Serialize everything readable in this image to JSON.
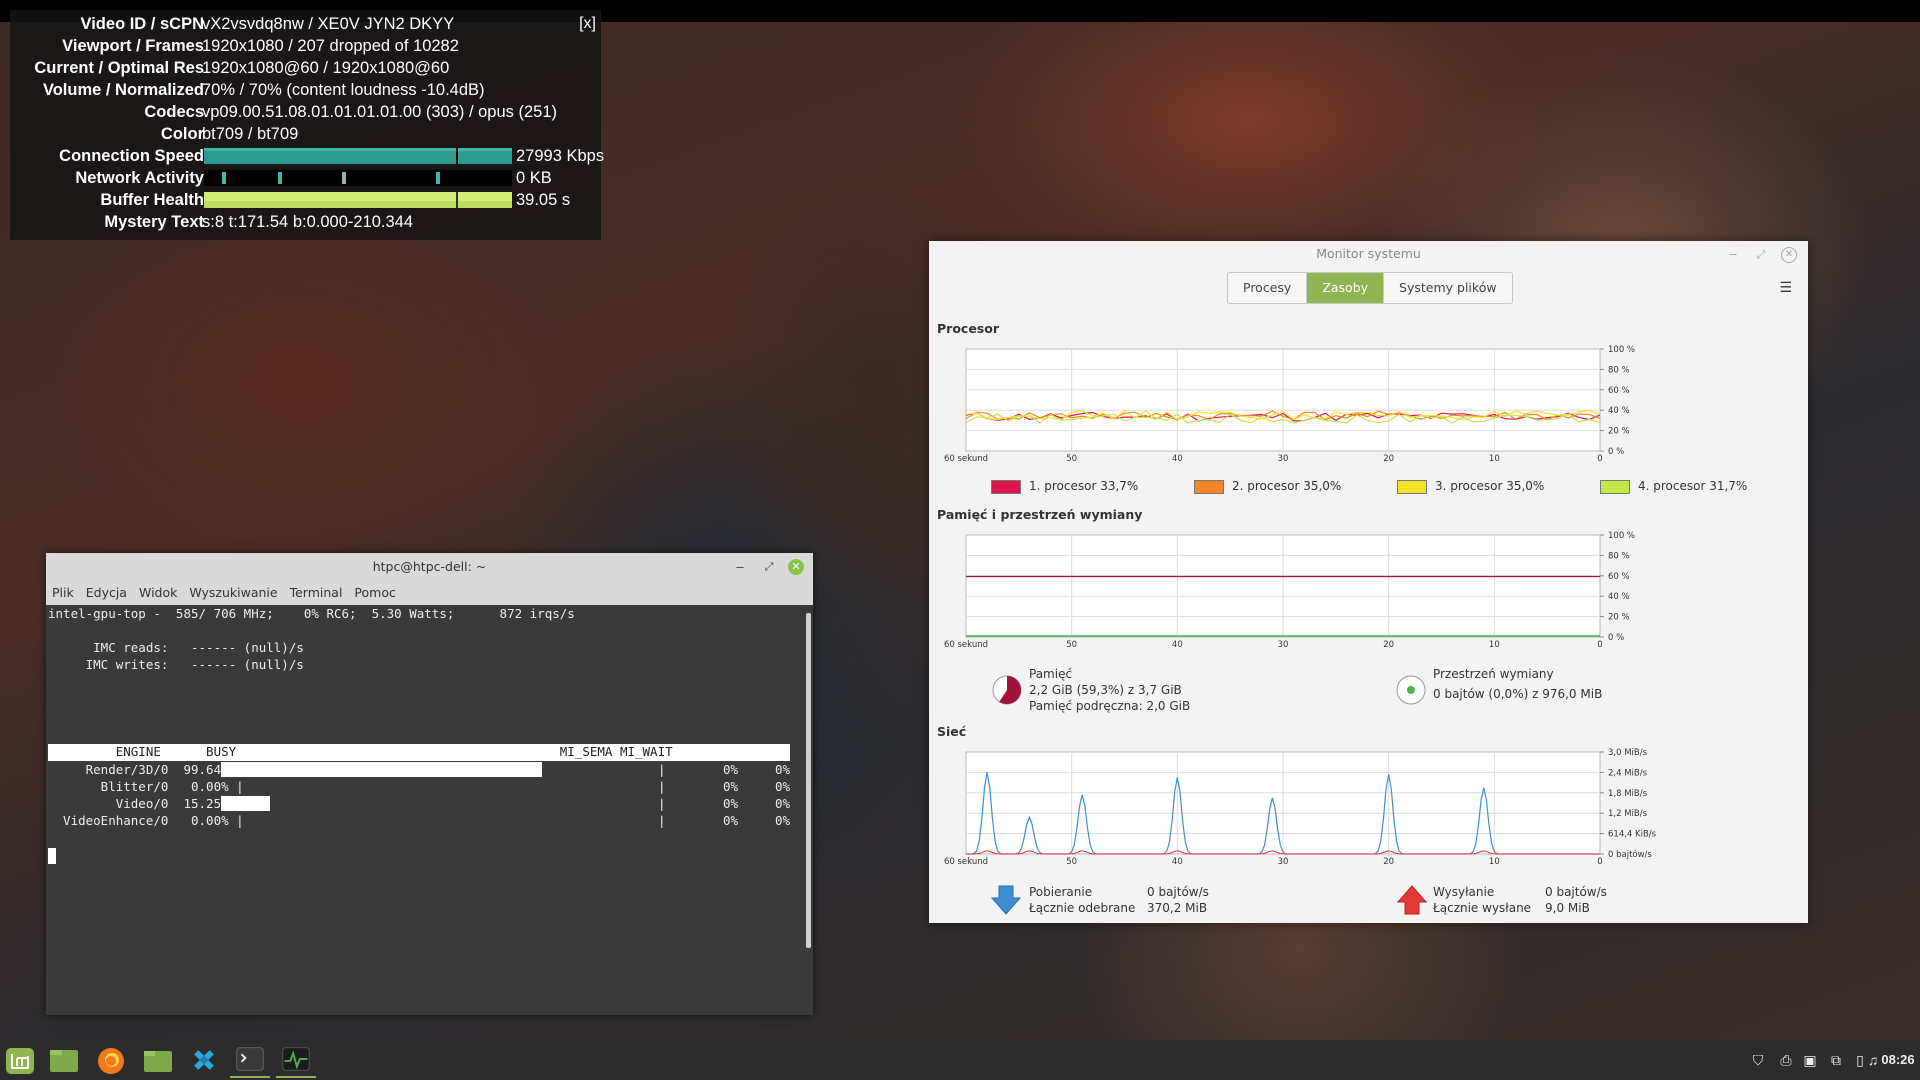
{
  "nerds": {
    "close_label": "[x]",
    "rows": [
      {
        "label": "Video ID / sCPN",
        "value": "vX2vsvdq8nw / XE0V JYN2 DKYY"
      },
      {
        "label": "Viewport / Frames",
        "value": "1920x1080 / 207 dropped of 10282"
      },
      {
        "label": "Current / Optimal Res",
        "value": "1920x1080@60 / 1920x1080@60"
      },
      {
        "label": "Volume / Normalized",
        "value": "70% / 70% (content loudness -10.4dB)"
      },
      {
        "label": "Codecs",
        "value": "vp09.00.51.08.01.01.01.01.00 (303) / opus (251)"
      },
      {
        "label": "Color",
        "value": "bt709 / bt709"
      },
      {
        "label": "Connection Speed",
        "value": "27993 Kbps"
      },
      {
        "label": "Network Activity",
        "value": "0 KB"
      },
      {
        "label": "Buffer Health",
        "value": "39.05 s"
      },
      {
        "label": "Mystery Text",
        "value": "s:8 t:171.54 b:0.000-210.344"
      }
    ],
    "colors": {
      "connection": "#3fb6a8",
      "network": "#3fb6a8",
      "buffer": "#d4ec7a"
    }
  },
  "terminal": {
    "title": "htpc@htpc-dell: ~",
    "menu": [
      "Plik",
      "Edycja",
      "Widok",
      "Wyszukiwanie",
      "Terminal",
      "Pomoc"
    ],
    "lines": [
      "intel-gpu-top -  585/ 706 MHz;    0% RC6;  5.30 Watts;      872 irqs/s",
      "",
      "      IMC reads:   ------ (null)/s",
      "     IMC writes:   ------ (null)/s"
    ],
    "header": "         ENGINE      BUSY                                           MI_SEMA MI_WAIT",
    "engines": [
      {
        "name": "     Render/3D/0",
        "busy": "99.64%",
        "fraction": 0.9964,
        "sema": "0%",
        "wait": "0%"
      },
      {
        "name": "       Blitter/0",
        "busy": " 0.00%",
        "fraction": 0.0,
        "sema": "0%",
        "wait": "0%"
      },
      {
        "name": "         Video/0",
        "busy": "15.25%",
        "fraction": 0.1525,
        "sema": "0%",
        "wait": "0%"
      },
      {
        "name": "  VideoEnhance/0",
        "busy": " 0.00%",
        "fraction": 0.0,
        "sema": "0%",
        "wait": "0%"
      }
    ]
  },
  "monitor": {
    "title": "Monitor systemu",
    "tabs": [
      "Procesy",
      "Zasoby",
      "Systemy plików"
    ],
    "active_tab": "Zasoby",
    "cpu": {
      "section": "Procesor",
      "x_ticks": [
        "60 sekund",
        "50",
        "40",
        "30",
        "20",
        "10",
        "0"
      ],
      "y_ticks": [
        "100 %",
        "80 %",
        "60 %",
        "40 %",
        "20 %",
        "0 %"
      ],
      "cores": [
        {
          "label": "1. procesor",
          "value": "33,7%",
          "color": "#e0144c"
        },
        {
          "label": "2. procesor",
          "value": "35,0%",
          "color": "#f5862a"
        },
        {
          "label": "3. procesor",
          "value": "35,0%",
          "color": "#f7e12a"
        },
        {
          "label": "4. procesor",
          "value": "31,7%",
          "color": "#c3e84a"
        }
      ]
    },
    "memory": {
      "section": "Pamięć i przestrzeń wymiany",
      "x_ticks": [
        "60 sekund",
        "50",
        "40",
        "30",
        "20",
        "10",
        "0"
      ],
      "y_ticks": [
        "100 %",
        "80 %",
        "60 %",
        "40 %",
        "20 %",
        "0 %"
      ],
      "mem_title": "Pamięć",
      "mem_line1": "2,2 GiB (59,3%) z 3,7 GiB",
      "mem_line2": "Pamięć podręczna: 2,0 GiB",
      "mem_fraction": 0.593,
      "mem_color": "#a0143c",
      "swap_title": "Przestrzeń wymiany",
      "swap_line": "0 bajtów (0,0%) z 976,0 MiB",
      "swap_fraction": 0.0,
      "swap_color": "#4caf50"
    },
    "network": {
      "section": "Sieć",
      "x_ticks": [
        "60 sekund",
        "50",
        "40",
        "30",
        "20",
        "10",
        "0"
      ],
      "y_ticks": [
        "3,0 MiB/s",
        "2,4 MiB/s",
        "1,8 MiB/s",
        "1,2 MiB/s",
        "614,4 KiB/s",
        "0 bajtów/s"
      ],
      "down_label": "Pobieranie",
      "down_value": "0 bajtów/s",
      "down_total_label": "Łącznie odebrane",
      "down_total": "370,2 MiB",
      "up_label": "Wysyłanie",
      "up_value": "0 bajtów/s",
      "up_total_label": "Łącznie wysłane",
      "up_total": "9,0 MiB",
      "down_color": "#3d8fd1",
      "up_color": "#e53935"
    }
  },
  "taskbar": {
    "apps": [
      "mint-menu-icon",
      "files-icon",
      "firefox-icon",
      "folder-icon",
      "kodi-icon",
      "terminal-icon",
      "system-monitor-icon"
    ],
    "clock": "08:26"
  }
}
